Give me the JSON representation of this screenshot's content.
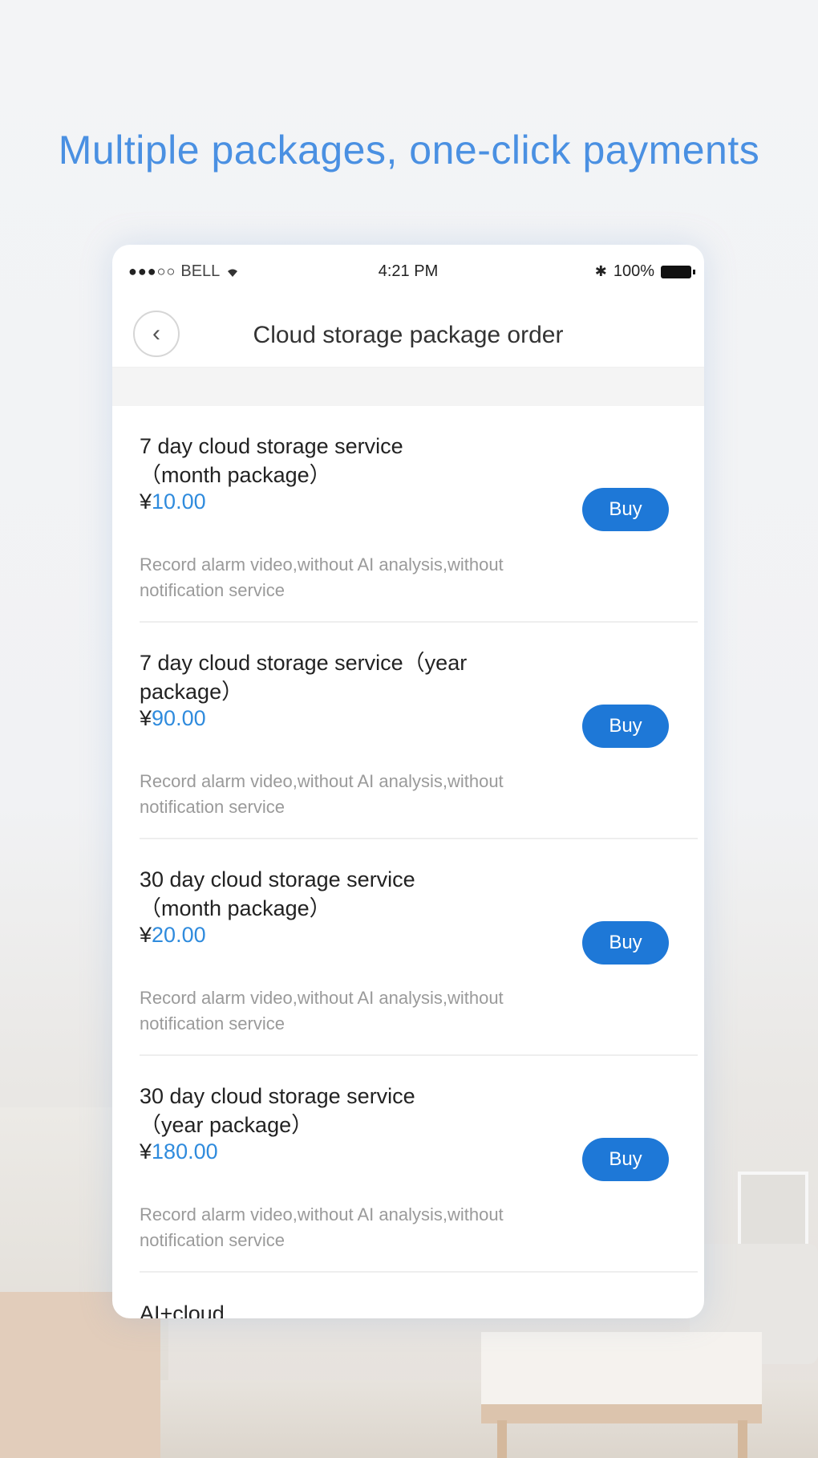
{
  "headline": "Multiple packages, one-click payments",
  "status_bar": {
    "signal": "●●●○○",
    "carrier": "BELL",
    "time": "4:21 PM",
    "bluetooth": "✱",
    "battery_text": "100%"
  },
  "nav": {
    "back_glyph": "‹",
    "title": "Cloud storage package order"
  },
  "packages": [
    {
      "title": "7 day cloud storage service（month package）",
      "currency": "¥",
      "price": "10.00",
      "description": "Record alarm video,without AI analysis,without  notification service",
      "buy_label": "Buy"
    },
    {
      "title": "7 day cloud storage service（year package）",
      "currency": "¥",
      "price": "90.00",
      "description": "Record alarm video,without AI analysis,without  notification service",
      "buy_label": "Buy"
    },
    {
      "title": "30 day cloud storage service（month package）",
      "currency": "¥",
      "price": "20.00",
      "description": "Record alarm video,without AI analysis,without  notification service",
      "buy_label": "Buy"
    },
    {
      "title": "30 day cloud storage service（year package）",
      "currency": "¥",
      "price": "180.00",
      "description": "Record alarm video,without AI analysis,without  notification service",
      "buy_label": "Buy"
    }
  ],
  "partial_item": {
    "title": "AI+cloud"
  },
  "colors": {
    "accent": "#1e78d7",
    "price": "#2f8bdd",
    "headline": "#4a90e2"
  }
}
